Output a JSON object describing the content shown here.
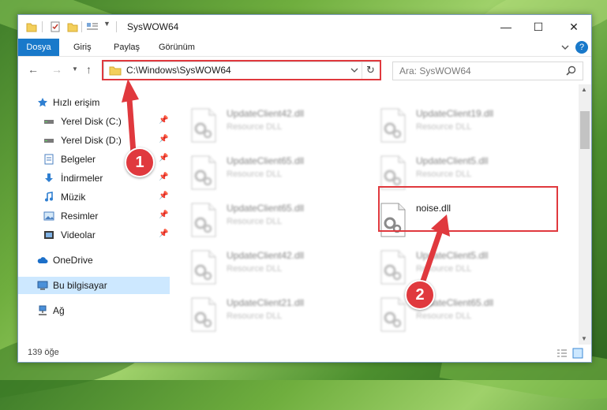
{
  "window": {
    "title": "SysWOW64"
  },
  "ribbon": {
    "tabs": [
      "Dosya",
      "Giriş",
      "Paylaş",
      "Görünüm"
    ],
    "help": "?"
  },
  "address": {
    "path": "C:\\Windows\\SysWOW64"
  },
  "search": {
    "placeholder": "Ara: SysWOW64"
  },
  "sidebar": {
    "items": [
      {
        "label": "Hızlı erişim",
        "icon": "star-icon"
      },
      {
        "label": "Yerel Disk (C:)",
        "icon": "drive-icon"
      },
      {
        "label": "Yerel Disk (D:)",
        "icon": "drive-icon"
      },
      {
        "label": "Belgeler",
        "icon": "documents-icon"
      },
      {
        "label": "İndirmeler",
        "icon": "download-icon"
      },
      {
        "label": "Müzik",
        "icon": "music-icon"
      },
      {
        "label": "Resimler",
        "icon": "pictures-icon"
      },
      {
        "label": "Videolar",
        "icon": "video-icon"
      },
      {
        "label": "OneDrive",
        "icon": "cloud-icon"
      },
      {
        "label": "Bu bilgisayar",
        "icon": "computer-icon"
      },
      {
        "label": "Ağ",
        "icon": "network-icon"
      }
    ]
  },
  "files": [
    {
      "name": "UpdateClient42.dll",
      "type": "Resource DLL"
    },
    {
      "name": "UpdateClient19.dll",
      "type": "Resource DLL"
    },
    {
      "name": "UpdateClient65.dll",
      "type": "Resource DLL"
    },
    {
      "name": "UpdateClient5.dll",
      "type": "Resource DLL"
    },
    {
      "name": "UpdateClient65.dll",
      "type": "Resource DLL"
    },
    {
      "name": "noise.dll",
      "type": ""
    },
    {
      "name": "UpdateClient42.dll",
      "type": "Resource DLL"
    },
    {
      "name": "UpdateClient5.dll",
      "type": "Resource DLL"
    },
    {
      "name": "UpdateClient21.dll",
      "type": "Resource DLL"
    },
    {
      "name": "UpdateClient65.dll",
      "type": "Resource DLL"
    }
  ],
  "status": {
    "count": "139 öğe"
  },
  "annotations": {
    "step1": "1",
    "step2": "2"
  },
  "colors": {
    "accent": "#1979ca",
    "highlight": "#e0393e",
    "selection": "#cde8ff"
  }
}
